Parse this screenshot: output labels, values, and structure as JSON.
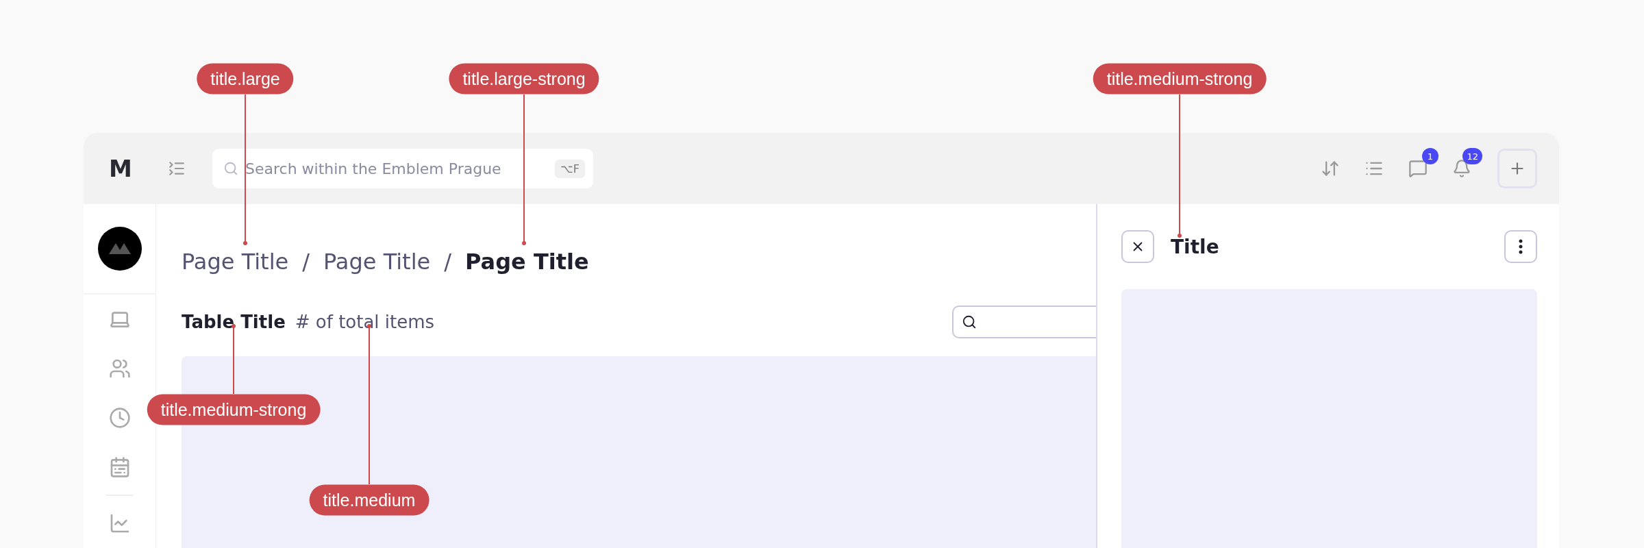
{
  "topbar": {
    "logo": "M",
    "search": {
      "placeholder": "Search within the Emblem Prague",
      "shortcut": "⌥F"
    },
    "badges": {
      "messages": "1",
      "notifications": "12"
    }
  },
  "breadcrumb": [
    {
      "label": "Page Title",
      "current": false
    },
    {
      "label": "Page Title",
      "current": false
    },
    {
      "label": "Page Title",
      "current": true
    }
  ],
  "breadcrumb_separator": "/",
  "table": {
    "title": "Table Title",
    "count": "# of total items"
  },
  "panel": {
    "title": "Title"
  },
  "annotations": [
    {
      "label": "title.large"
    },
    {
      "label": "title.large-strong"
    },
    {
      "label": "title.medium-strong"
    },
    {
      "label": "title.medium-strong"
    },
    {
      "label": "title.medium"
    }
  ]
}
